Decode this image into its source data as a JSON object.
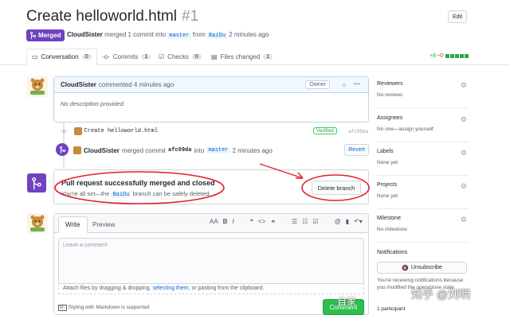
{
  "header": {
    "title": "Create helloworld.html",
    "number": "#1",
    "edit_label": "Edit",
    "status": "Merged",
    "author": "CloudSister",
    "merge_text_1": "merged 1 commit into",
    "base_branch": "master",
    "merge_text_2": "from",
    "head_branch": "BaiDu",
    "time_ago": "2 minutes ago"
  },
  "tabs": [
    {
      "label": "Conversation",
      "count": "0",
      "icon": "comment-discussion-icon"
    },
    {
      "label": "Commits",
      "count": "1",
      "icon": "git-commit-icon"
    },
    {
      "label": "Checks",
      "count": "0",
      "icon": "checklist-icon"
    },
    {
      "label": "Files changed",
      "count": "1",
      "icon": "file-diff-icon"
    }
  ],
  "diffstat": {
    "additions": "+8",
    "deletions": "−0"
  },
  "comment": {
    "author": "CloudSister",
    "action": "commented 4 minutes ago",
    "role": "Owner",
    "body": "No description provided."
  },
  "commit": {
    "message": "Create helloworld.html",
    "verified": "Verified",
    "sha": "afc09da"
  },
  "merge_event": {
    "author": "CloudSister",
    "text_1": "merged commit",
    "sha": "afc09da",
    "text_2": "into",
    "branch": "master",
    "time": "2 minutes ago",
    "revert_label": "Revert"
  },
  "merged_box": {
    "title": "Pull request successfully merged and closed",
    "sub_1": "You're all set—the",
    "branch": "BaiDu",
    "sub_2": "branch can be safely deleted.",
    "delete_label": "Delete branch"
  },
  "editor": {
    "write_tab": "Write",
    "preview_tab": "Preview",
    "placeholder": "Leave a comment",
    "attach_1": "Attach files by dragging & dropping,",
    "attach_link": "selecting them",
    "attach_2": ", or pasting from the clipboard.",
    "md_note": "Styling with Markdown is supported",
    "comment_label": "Comment"
  },
  "sidebar": {
    "reviewers": {
      "title": "Reviewers",
      "value": "No reviews"
    },
    "assignees": {
      "title": "Assignees",
      "value": "No one—assign yourself"
    },
    "labels": {
      "title": "Labels",
      "value": "None yet"
    },
    "projects": {
      "title": "Projects",
      "value": "None yet"
    },
    "milestone": {
      "title": "Milestone",
      "value": "No milestone"
    },
    "notifications": {
      "title": "Notifications",
      "unsubscribe_label": "Unsubscribe",
      "text": "You're receiving notifications because you modified the open/close state."
    },
    "participants": "1 participant"
  },
  "watermark": {
    "text": "知乎 @刘明",
    "text2": "自家"
  },
  "colors": {
    "merged": "#6f42c1",
    "annotation": "#e0202a",
    "success": "#2cbe4e"
  }
}
